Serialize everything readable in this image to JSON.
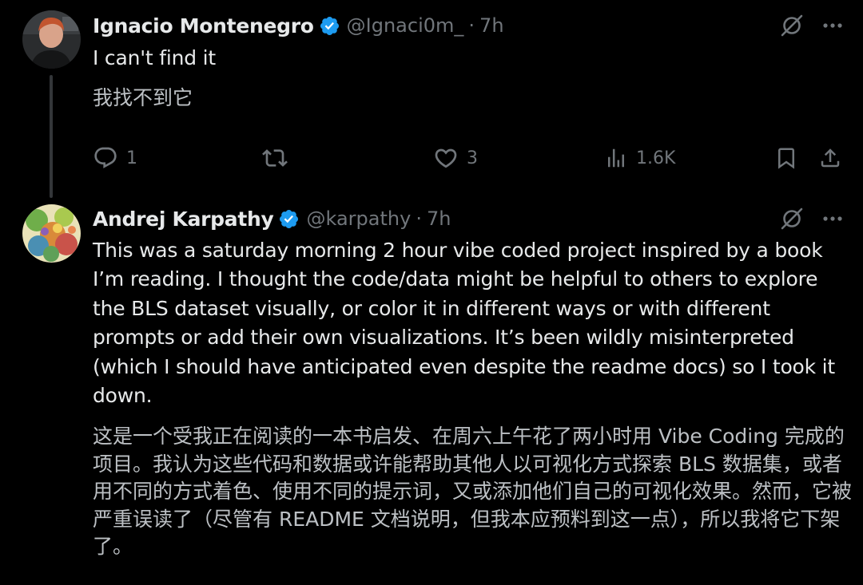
{
  "colors": {
    "background": "#000000",
    "primary_text": "#e7e9ea",
    "secondary_text": "#71767b",
    "translation_text": "#bcc0c4",
    "verified_blue": "#1d9bf0",
    "thread_line": "#333639"
  },
  "tweets": [
    {
      "author_name": "Ignacio Montenegro",
      "handle": "@Ignaci0m_",
      "separator": "·",
      "time": "7h",
      "verified": true,
      "avatar_icon": "avatar-photo-red-hair",
      "text": "I can't find it",
      "translation": "我找不到它",
      "actions": {
        "reply_count": "1",
        "repost_count": "",
        "like_count": "3",
        "views_count": "1.6K"
      }
    },
    {
      "author_name": "Andrej Karpathy",
      "handle": "@karpathy",
      "separator": "·",
      "time": "7h",
      "verified": true,
      "avatar_icon": "avatar-illustration-colorful",
      "text": "This was a saturday morning 2 hour vibe coded project inspired by a book I’m reading. I thought the code/data might be helpful to others to explore the BLS dataset visually, or color it in different ways or with different prompts or add their own visualizations. It’s been wildly misinterpreted (which I should have anticipated even despite the readme docs) so I took it down.",
      "translation": "这是一个受我正在阅读的一本书启发、在周六上午花了两小时用 Vibe Coding 完成的项目。我认为这些代码和数据或许能帮助其他人以可视化方式探索 BLS 数据集，或者用不同的方式着色、使用不同的提示词，又或添加他们自己的可视化效果。然而，它被严重误读了（尽管有 README 文档说明，但我本应预料到这一点），所以我将它下架了。"
    }
  ]
}
